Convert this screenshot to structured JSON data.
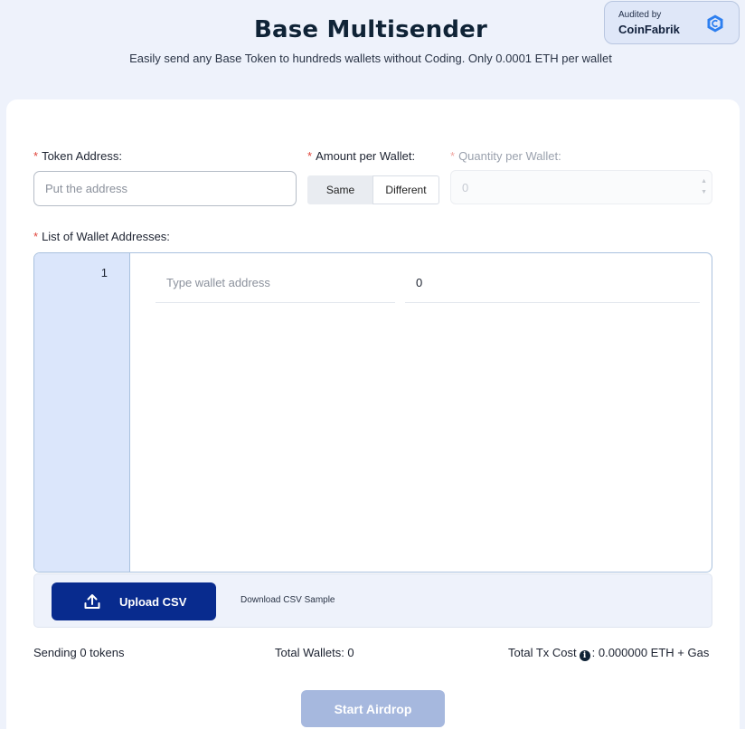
{
  "header": {
    "title": "Base Multisender",
    "subtitle": "Easily send any Base Token to hundreds wallets without Coding. Only 0.0001 ETH per wallet"
  },
  "audit": {
    "label": "Audited by",
    "name": "CoinFabrik",
    "icon": "coinfabrik-logo-icon",
    "accent": "#2d7ff0"
  },
  "form": {
    "required_mark": "*",
    "token_label": "Token Address:",
    "token_placeholder": "Put the address",
    "amount_label": "Amount per Wallet:",
    "amount_options": [
      "Same",
      "Different"
    ],
    "quantity_label": "Quantity per Wallet:",
    "quantity_value": "0",
    "list_label": "List of Wallet Addresses:"
  },
  "wallet_list": {
    "rows": [
      {
        "index": "1",
        "address_placeholder": "Type wallet address",
        "amount": "0"
      }
    ]
  },
  "csv": {
    "upload_label": "Upload CSV",
    "upload_icon": "upload-icon",
    "download_label": "Download CSV Sample"
  },
  "summary": {
    "sending": "Sending 0 tokens",
    "total_wallets": "Total Wallets: 0",
    "tx_cost_label": "Total Tx Cost",
    "tx_cost_value": ": 0.000000 ETH + Gas",
    "info_icon": "info-icon"
  },
  "actions": {
    "start_label": "Start Airdrop"
  },
  "colors": {
    "primary_button": "#082b8e",
    "disabled_button": "#a6b8de",
    "required": "#e0433a",
    "page_bg": "#eef2fb"
  }
}
